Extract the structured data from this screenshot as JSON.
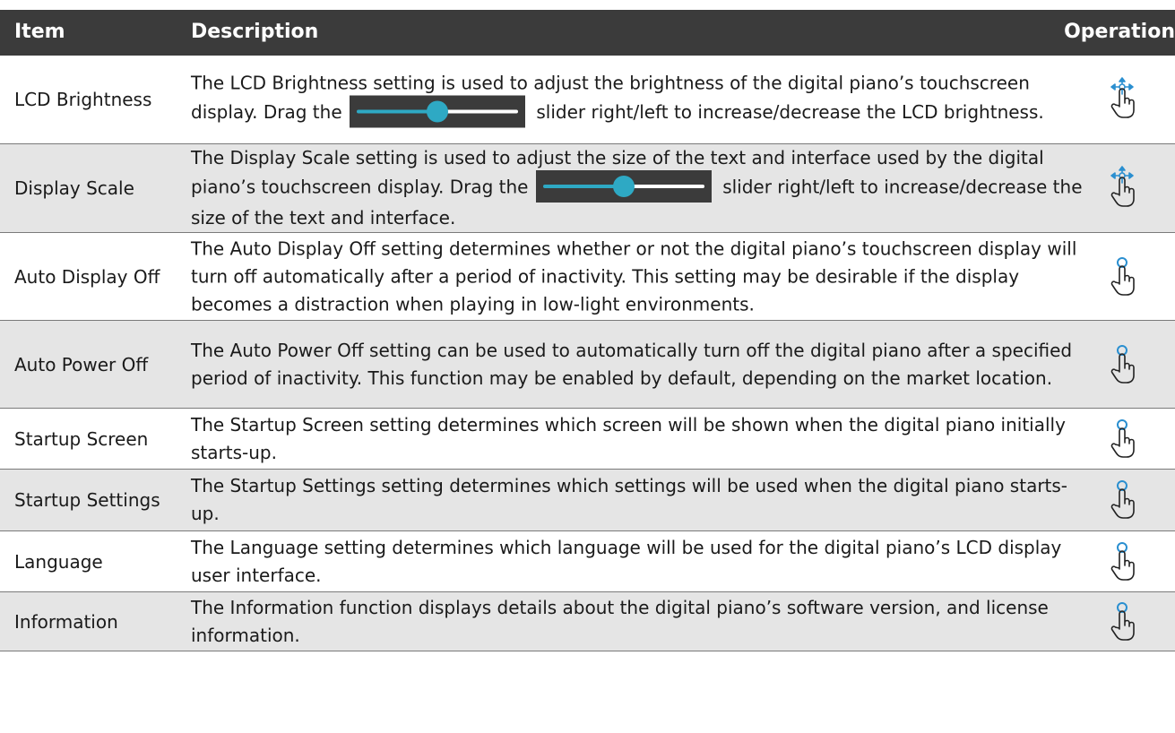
{
  "table": {
    "headers": {
      "item": "Item",
      "description": "Description",
      "operation": "Operation"
    },
    "rows": [
      {
        "item": "LCD Brightness",
        "desc_before_slider": "The LCD Brightness setting is used to adjust the brightness of the digital piano’s touchscreen display. Drag the",
        "desc_after_slider": "slider right/left to increase/decrease the LCD brightness.",
        "slider_value_fraction": 0.5,
        "operation_icon": "drag-gesture-icon"
      },
      {
        "item": "Display Scale",
        "desc_before_slider": "The Display Scale setting is used to adjust the size of the text and interface used by the digital piano’s touchscreen display. Drag the",
        "desc_after_slider": "slider right/left to increase/decrease the size of the text and interface.",
        "slider_value_fraction": 0.5,
        "operation_icon": "drag-gesture-icon"
      },
      {
        "item": "Auto Display Off",
        "description": "The Auto Display Off setting determines whether or not the digital piano’s touchscreen display will turn off automatically after a period of inactivity. This setting may be desirable if the display becomes a distraction when playing in low-light environments.",
        "operation_icon": "tap-gesture-icon"
      },
      {
        "item": "Auto Power Off",
        "description": "The Auto Power Off setting can be used to automatically turn off the digital piano after a specified period of inactivity. This function may be enabled by default, depending on the market location.",
        "operation_icon": "tap-gesture-icon"
      },
      {
        "item": "Startup Screen",
        "description": "The Startup Screen setting determines which screen will be shown when the digital piano initially starts-up.",
        "operation_icon": "tap-gesture-icon"
      },
      {
        "item": "Startup Settings",
        "description": "The Startup Settings setting determines which settings will be used when the digital piano starts-up.",
        "operation_icon": "tap-gesture-icon"
      },
      {
        "item": "Language",
        "description": "The Language setting determines which language will be used for the digital piano’s LCD display user interface.",
        "operation_icon": "tap-gesture-icon"
      },
      {
        "item": "Information",
        "description": "The Information function displays details about the digital piano’s software version, and license information.",
        "operation_icon": "tap-gesture-icon"
      }
    ]
  },
  "colors": {
    "header_bg": "#3b3b3b",
    "alt_row_bg": "#e5e5e5",
    "accent": "#2ea9c4"
  }
}
